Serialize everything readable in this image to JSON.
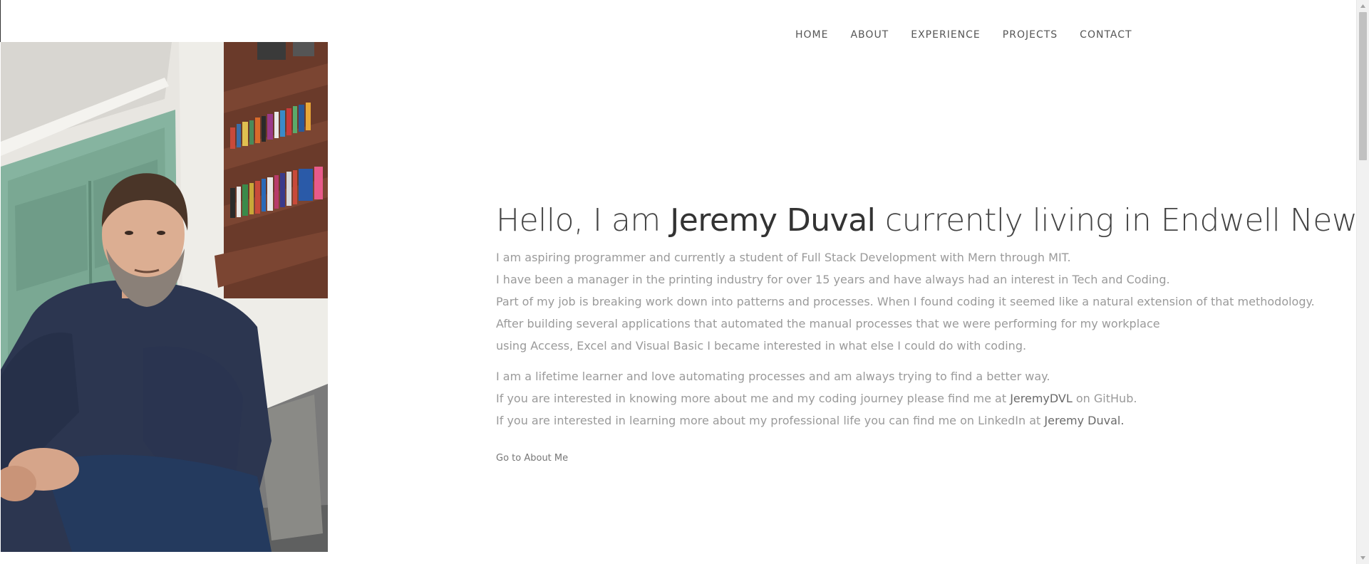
{
  "nav": {
    "items": [
      {
        "label": "HOME"
      },
      {
        "label": "ABOUT"
      },
      {
        "label": "EXPERIENCE"
      },
      {
        "label": "PROJECTS"
      },
      {
        "label": "CONTACT"
      }
    ]
  },
  "hero": {
    "headline_prefix": "Hello, I am ",
    "headline_name": "Jeremy Duval",
    "headline_suffix": " currently living in Endwell New York",
    "para1": [
      "I am aspiring programmer and currently a student of Full Stack Development with Mern through MIT.",
      "I have been a manager in the printing industry for over 15 years and have always had an interest in Tech and Coding.",
      "Part of my job is breaking work down into patterns and processes. When I found coding it seemed like a natural extension of that methodology.",
      "After building several applications that automated the manual processes that we were performing for my workplace",
      "using Access, Excel and Visual Basic I became interested in what else I could do with coding."
    ],
    "para2_line1": "I am a lifetime learner and love automating processes and am always trying to find a better way.",
    "para2_line2_prefix": "If you are interested in knowing more about me and my coding journey please find me at ",
    "github_link": "JeremyDVL",
    "para2_line2_suffix": " on GitHub.",
    "para2_line3_prefix": "If you are interested in learning more about my professional life you can find me on LinkedIn at ",
    "linkedin_link": "Jeremy Duval.",
    "cta": "Go to About Me"
  },
  "colors": {
    "background": "#ffffff",
    "heading": "#444444",
    "body_text": "#9a9a9a",
    "link": "#6a6a6a"
  }
}
